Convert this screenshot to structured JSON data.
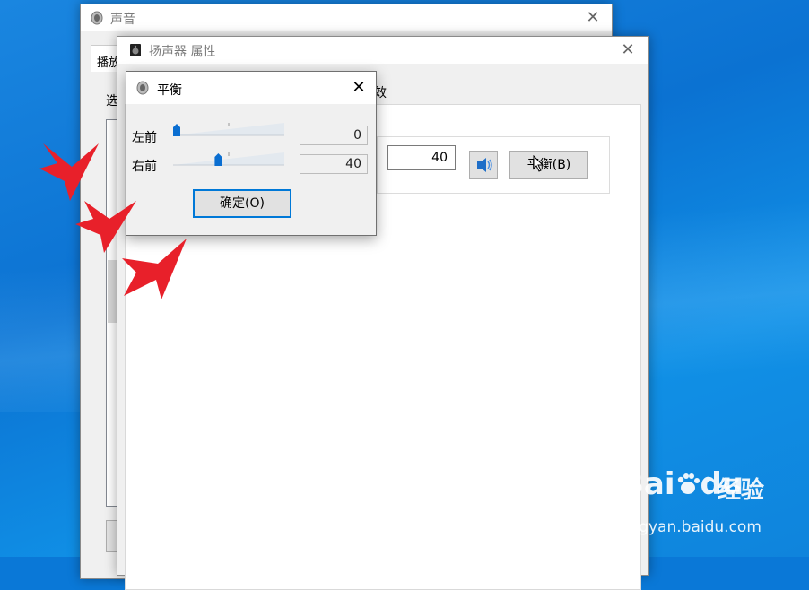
{
  "sound_window": {
    "title": "声音",
    "close_glyph": "✕",
    "tab_fragment": "播放",
    "select_label_fragment": "选"
  },
  "speaker_props_window": {
    "title": "扬声器 属性",
    "close_glyph": "✕",
    "tab_fragment": "效",
    "level_value": "40",
    "balance_button_label": "平衡(B)",
    "speaker_icon": "speaker-icon"
  },
  "balance_dialog": {
    "title": "平衡",
    "close_glyph": "✕",
    "left_front": {
      "label": "左前",
      "value": "0",
      "slider_fraction": 0.0
    },
    "right_front": {
      "label": "右前",
      "value": "40",
      "slider_fraction": 0.4
    },
    "ok_button_label": "确定(O)"
  },
  "annotations": {
    "arrow_color": "#e8202a",
    "arrow_count": 3
  },
  "watermark": {
    "brand": "Bai",
    "brand_suffix": "du",
    "product": "经验",
    "url": "jingyan.baidu.com"
  },
  "colors": {
    "accent": "#0078d7",
    "desktop": "#0a78d7"
  }
}
